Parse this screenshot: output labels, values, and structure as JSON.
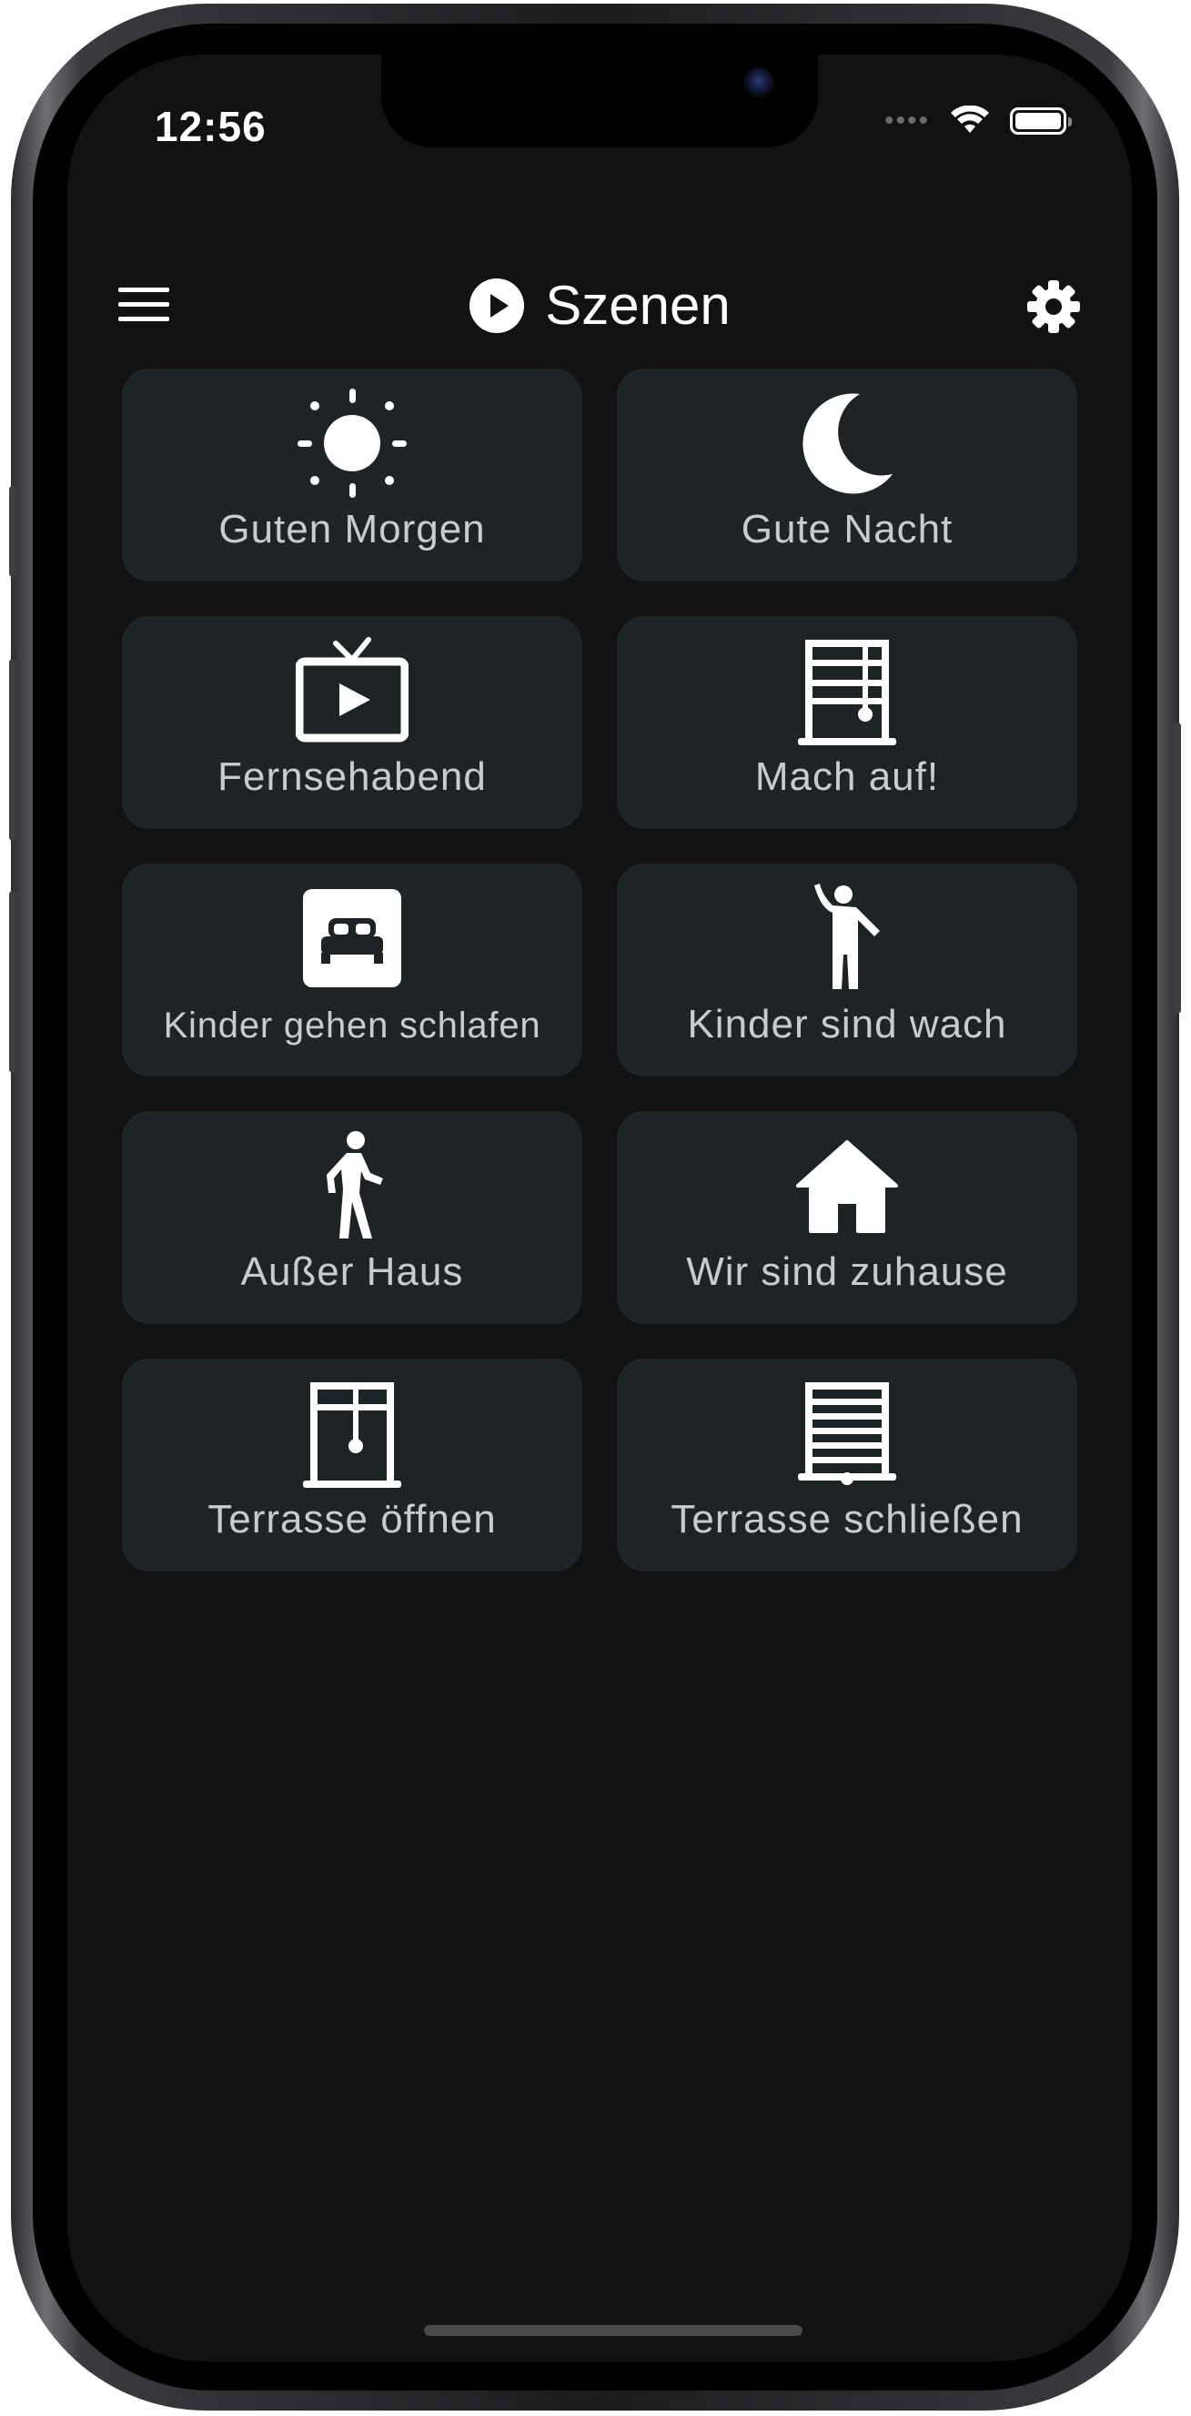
{
  "status_bar": {
    "time": "12:56",
    "signal": "••••"
  },
  "header": {
    "title": "Szenen"
  },
  "scenes": [
    {
      "label": "Guten Morgen",
      "icon": "sun-icon"
    },
    {
      "label": "Gute Nacht",
      "icon": "moon-icon"
    },
    {
      "label": "Fernsehabend",
      "icon": "tv-icon"
    },
    {
      "label": "Mach auf!",
      "icon": "blinds-open-icon"
    },
    {
      "label": "Kinder gehen schlafen",
      "icon": "bed-icon"
    },
    {
      "label": "Kinder sind wach",
      "icon": "person-waving-icon"
    },
    {
      "label": "Außer Haus",
      "icon": "person-walking-icon"
    },
    {
      "label": "Wir sind zuhause",
      "icon": "home-icon"
    },
    {
      "label": "Terrasse öffnen",
      "icon": "blinds-open-icon"
    },
    {
      "label": "Terrasse schließen",
      "icon": "blinds-closed-icon"
    }
  ],
  "colors": {
    "background": "#121212",
    "tile": "#1e2326",
    "label": "#c9cccf",
    "icon": "#ffffff"
  }
}
